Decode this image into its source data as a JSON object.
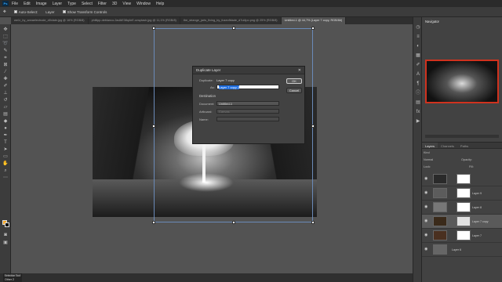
{
  "menubar": {
    "logo": "Ps",
    "items": [
      "File",
      "Edit",
      "Image",
      "Layer",
      "Type",
      "Select",
      "Filter",
      "3D",
      "View",
      "Window",
      "Help"
    ]
  },
  "options": {
    "auto_select_label": "Auto-Select:",
    "auto_select_value": "Layer",
    "show_transform_label": "Show Transform Controls"
  },
  "tabs": [
    {
      "label": "we1r_by_annaelectrode_d0xlabr.jpg @ 16% (RGB/8)",
      "active": false
    },
    {
      "label": "phillipp-deblanco-2adAE38q4nE-unsplash.jpg @ 11,1% (RGB/8)",
      "active": false
    },
    {
      "label": "the_strange_jarts_fixing_by_fuseofblade_d7ui4po.png @ 25% (RGB/8)",
      "active": false
    },
    {
      "label": "Untitled-1 @ 44,7% (Layer 7 copy, RGB/8#)",
      "active": true
    }
  ],
  "dialog": {
    "title": "Duplicate Layer",
    "duplicate_label": "Duplicate:",
    "duplicate_value": "Layer 7 copy",
    "as_label": "As:",
    "as_value": "Layer 7 copy 2",
    "destination_label": "Destination",
    "document_label": "Document:",
    "document_value": "Untitled-1",
    "artboard_label": "Artboard:",
    "artboard_value": "Canvas",
    "name_label": "Name:",
    "ok_label": "OK",
    "cancel_label": "Cancel"
  },
  "navigator": {
    "tab_label": "Navigator"
  },
  "layers": {
    "tabs": [
      "Layers",
      "Channels",
      "Paths"
    ],
    "kind_label": "Kind",
    "blend_label": "Normal",
    "opacity_label": "Opacity:",
    "lock_label": "Lock:",
    "fill_label": "Fill:",
    "items": [
      {
        "name": "",
        "active": false,
        "has_mask": true
      },
      {
        "name": "Layer 9",
        "active": false,
        "has_mask": true
      },
      {
        "name": "Layer 8",
        "active": false,
        "has_mask": true
      },
      {
        "name": "Layer 7 copy",
        "active": true,
        "has_mask": true
      },
      {
        "name": "Layer 7",
        "active": false,
        "has_mask": true
      },
      {
        "name": "Layer 6",
        "active": false,
        "has_mask": false
      }
    ]
  },
  "status": {
    "tooltip": "Selection Tool",
    "document": "Other 2"
  },
  "colors": {
    "foreground": "#f5a623",
    "background": "#111111",
    "accent": "#1f6ee0",
    "navigator_frame": "#d0321e"
  }
}
